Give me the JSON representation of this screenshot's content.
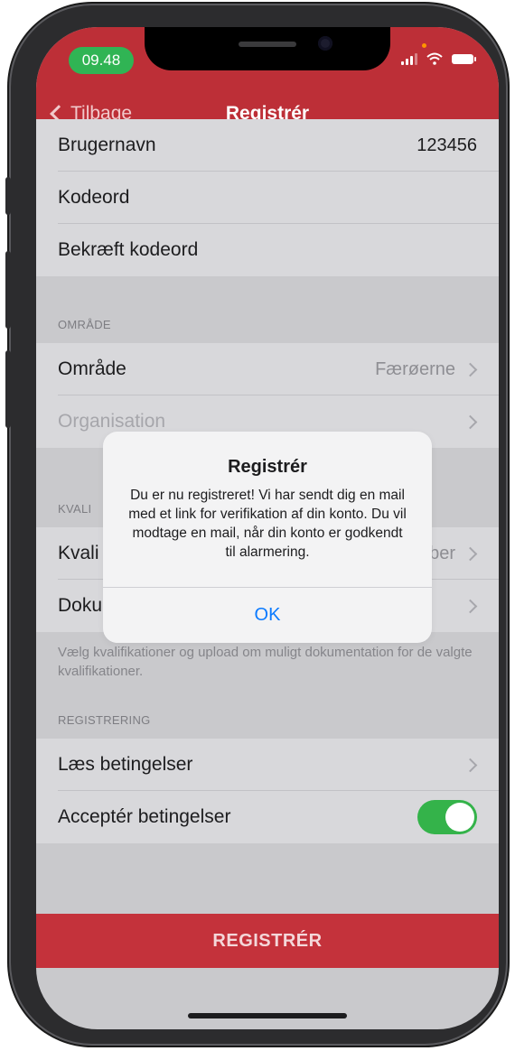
{
  "status_bar": {
    "time": "09.48"
  },
  "nav": {
    "back_label": "Tilbage",
    "title": "Registrér"
  },
  "account_section": {
    "rows": [
      {
        "label": "Brugernavn",
        "value": "123456"
      },
      {
        "label": "Kodeord"
      },
      {
        "label": "Bekræft kodeord"
      }
    ]
  },
  "area_section": {
    "header": "OMRÅDE",
    "rows": [
      {
        "label": "Område",
        "value": "Færøerne"
      },
      {
        "label": "Organisation",
        "value": ""
      }
    ]
  },
  "qualifications_section": {
    "header": "KVALI",
    "rows": [
      {
        "label": "Kvali",
        "value": "ber"
      },
      {
        "label": "Doku"
      }
    ],
    "footer": "Vælg kvalifikationer og upload om muligt dokumentation for de valgte kvalifikationer."
  },
  "registration_section": {
    "header": "REGISTRERING",
    "rows": [
      {
        "label": "Læs betingelser"
      },
      {
        "label": "Acceptér betingelser",
        "toggle_on": true
      }
    ]
  },
  "register_button": {
    "label": "REGISTRÉR"
  },
  "alert": {
    "title": "Registrér",
    "message": "Du er nu registreret! Vi har sendt dig en mail med et link for verifikation af din konto. Du vil modtage en mail, når din konto er godkendt til alarmering.",
    "ok_label": "OK"
  },
  "colors": {
    "nav_red": "#bd2f37",
    "button_red": "#c4323b",
    "toggle_green": "#34b34a",
    "time_pill_green": "#30b454",
    "link_blue": "#0a7aff"
  },
  "icons": [
    "back-chevron-icon",
    "signal-icon",
    "wifi-icon",
    "battery-icon",
    "chevron-right-icon"
  ]
}
